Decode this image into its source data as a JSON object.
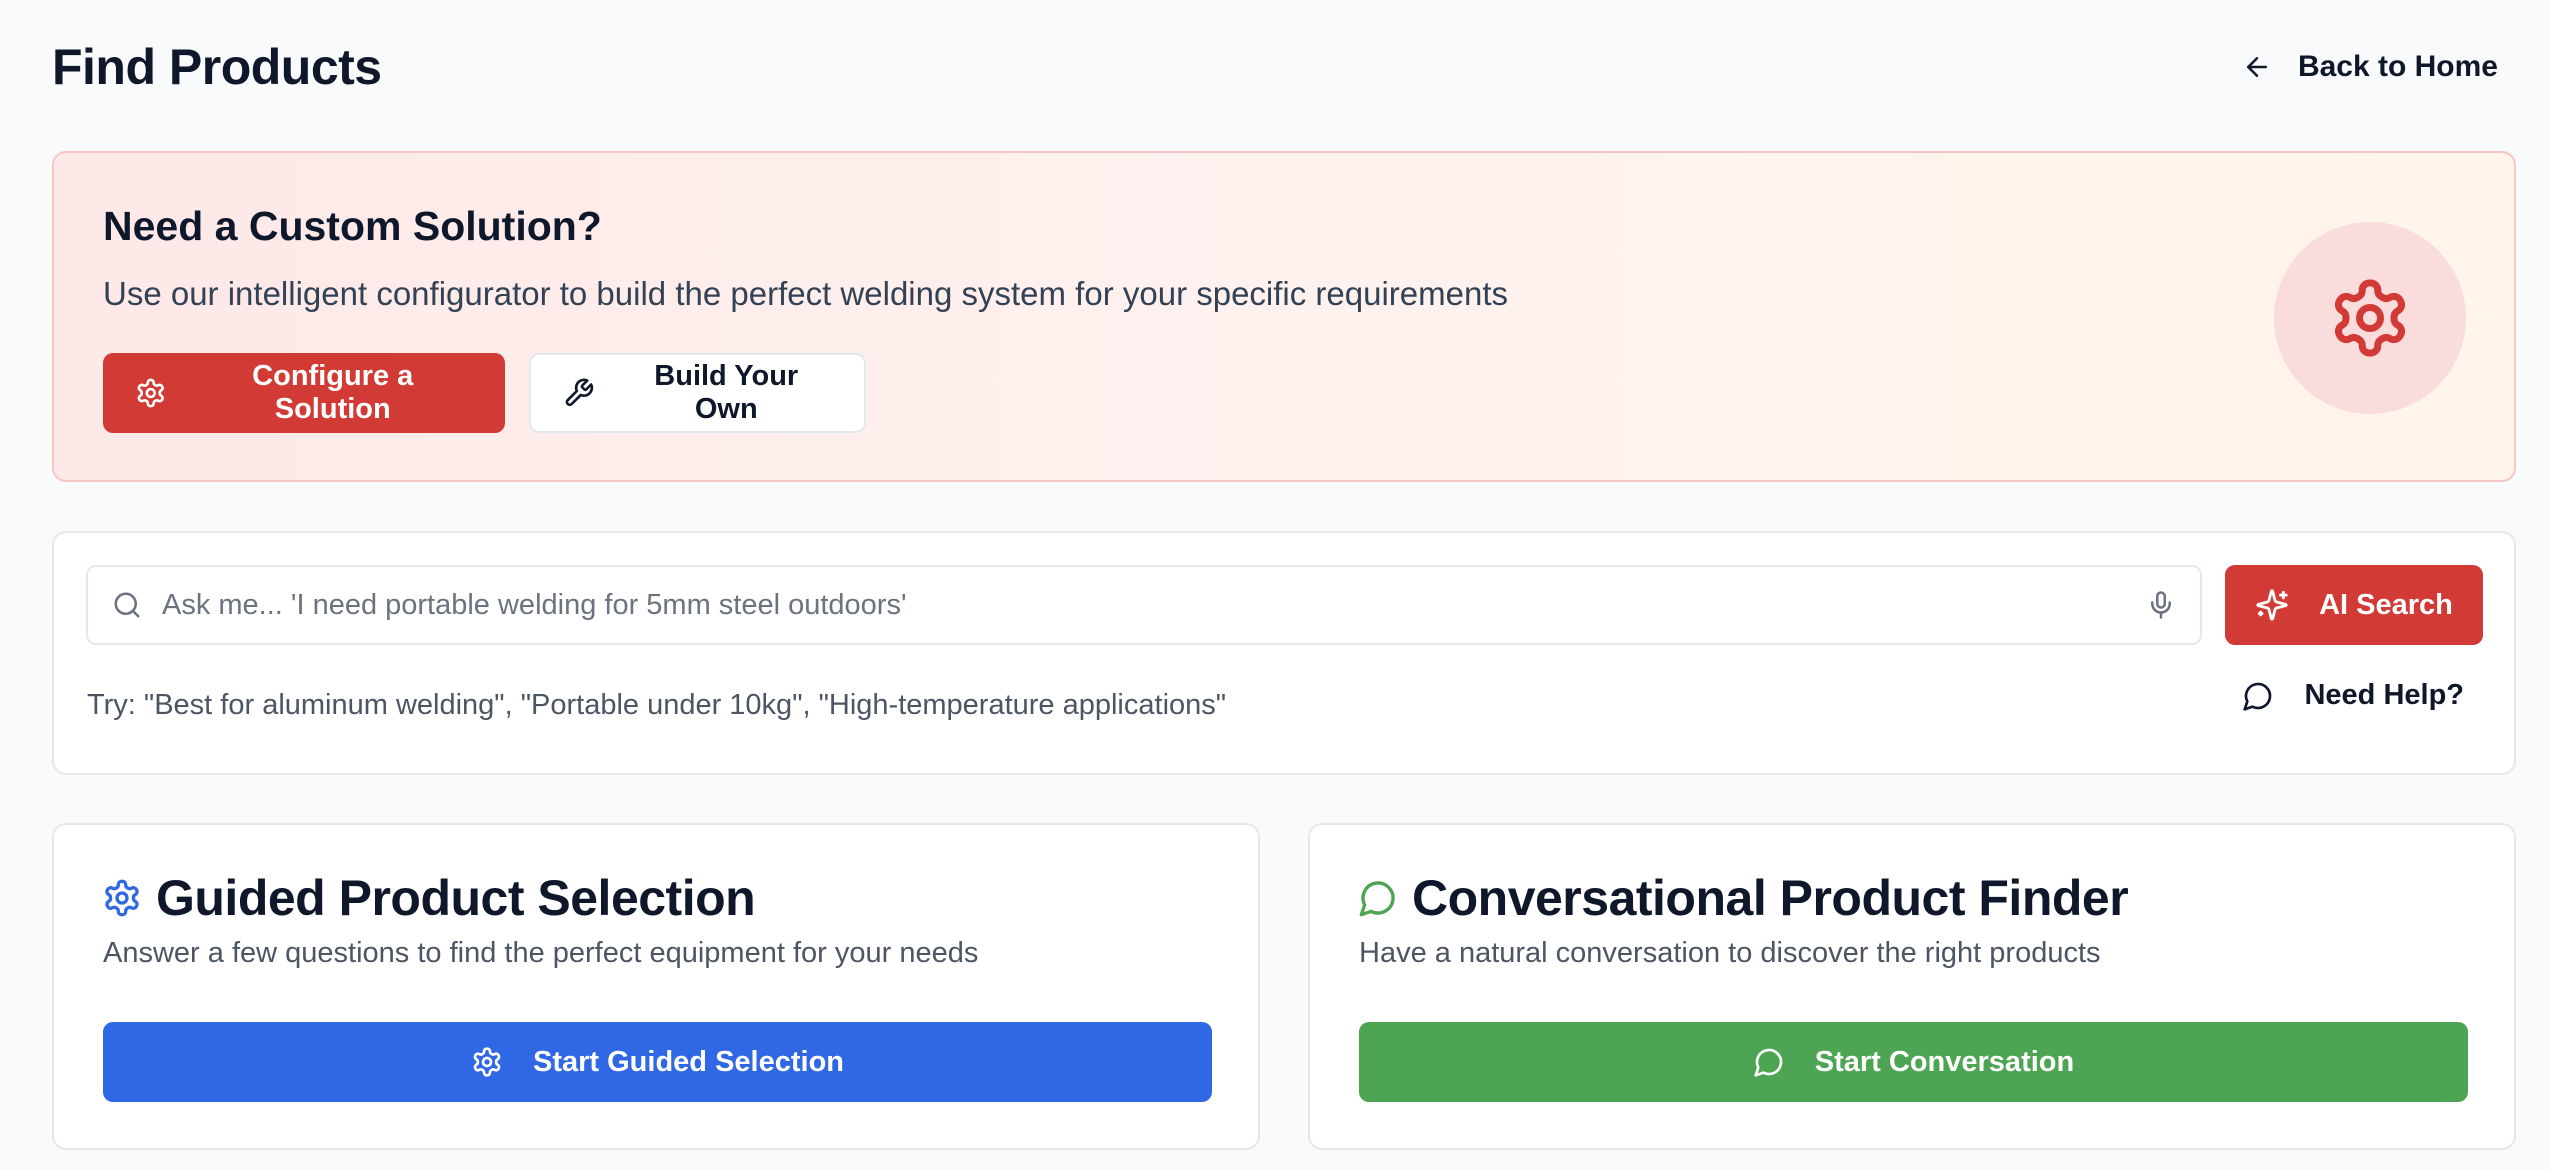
{
  "header": {
    "title": "Find Products",
    "back_label": "Back to Home",
    "back_icon": "arrow-left-icon"
  },
  "promo": {
    "title": "Need a Custom Solution?",
    "subtitle": "Use our intelligent configurator to build the perfect welding system for your specific requirements",
    "configure_label": "Configure a Solution",
    "build_label": "Build Your Own",
    "badge_icon": "gear-icon",
    "accent": "#d23a35"
  },
  "search": {
    "placeholder": "Ask me... 'I need portable welding for 5mm steel outdoors'",
    "value": "",
    "ai_button_label": "AI Search",
    "try_text": "Try: \"Best for aluminum welding\", \"Portable under 10kg\", \"High-temperature applications\"",
    "help_label": "Need Help?"
  },
  "features": {
    "guided": {
      "title": "Guided Product Selection",
      "description": "Answer a few questions to find the perfect equipment for your needs",
      "button_label": "Start Guided Selection",
      "color": "#3067e4"
    },
    "conversational": {
      "title": "Conversational Product Finder",
      "description": "Have a natural conversation to discover the right products",
      "button_label": "Start Conversation",
      "color": "#4da453"
    }
  }
}
